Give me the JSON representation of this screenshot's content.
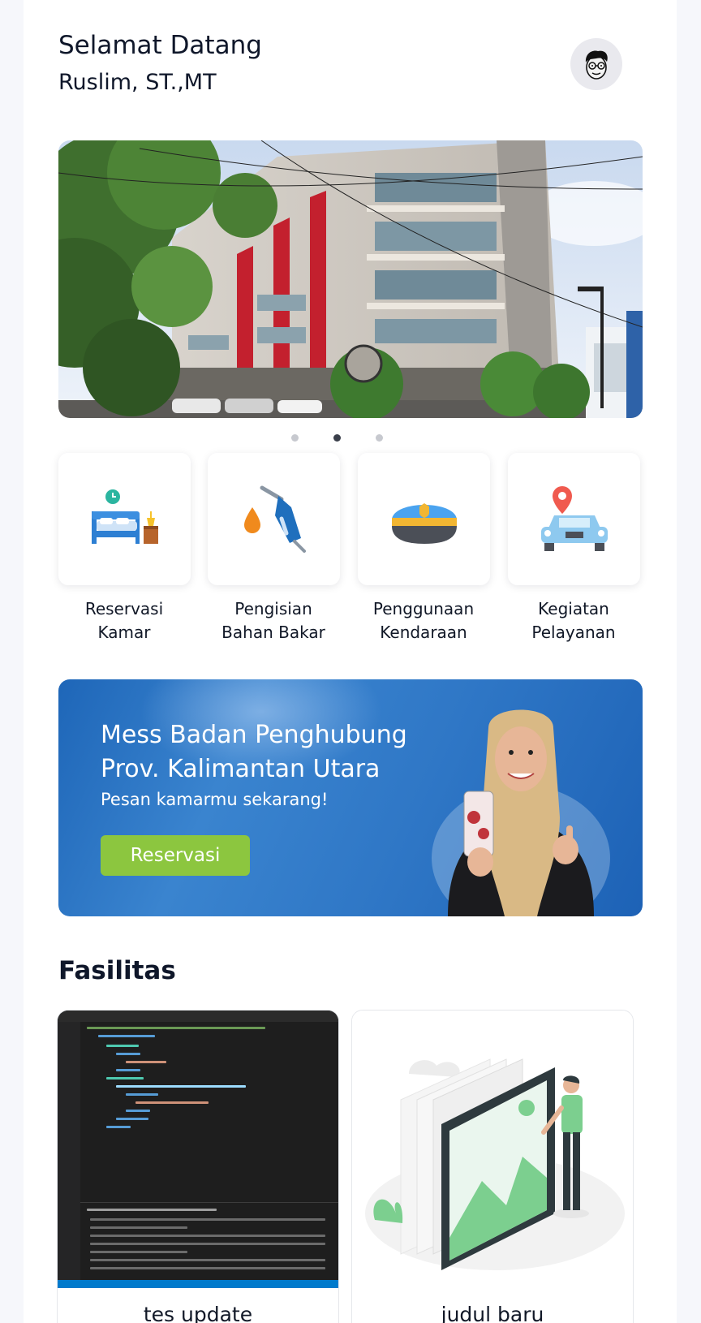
{
  "header": {
    "greeting": "Selamat Datang",
    "user_name": "Ruslim, ST.,MT"
  },
  "avatar": {
    "icon": "cartoon-man-with-glasses-icon"
  },
  "carousel": {
    "slide_count": 3,
    "active_index": 1
  },
  "menu": [
    {
      "label_line1": "Reservasi",
      "label_line2": "Kamar",
      "icon": "bed-with-clock-icon"
    },
    {
      "label_line1": "Pengisian",
      "label_line2": "Bahan Bakar",
      "icon": "fuel-nozzle-icon"
    },
    {
      "label_line1": "Penggunaan",
      "label_line2": "Kendaraan",
      "icon": "officer-cap-icon"
    },
    {
      "label_line1": "Kegiatan",
      "label_line2": "Pelayanan",
      "icon": "car-with-location-pin-icon"
    }
  ],
  "promo": {
    "title_line1": "Mess Badan Penghubung",
    "title_line2": "Prov. Kalimantan Utara",
    "subtitle": "Pesan kamarmu sekarang!",
    "button_label": "Reservasi",
    "button_color": "#8cc63f",
    "background_color": "#2a73c4"
  },
  "facilities": {
    "title": "Fasilitas",
    "items": [
      {
        "title": "tes update",
        "image": "code-editor-screenshot"
      },
      {
        "title": "judul baru",
        "image": "image-placeholder-illustration"
      }
    ]
  }
}
